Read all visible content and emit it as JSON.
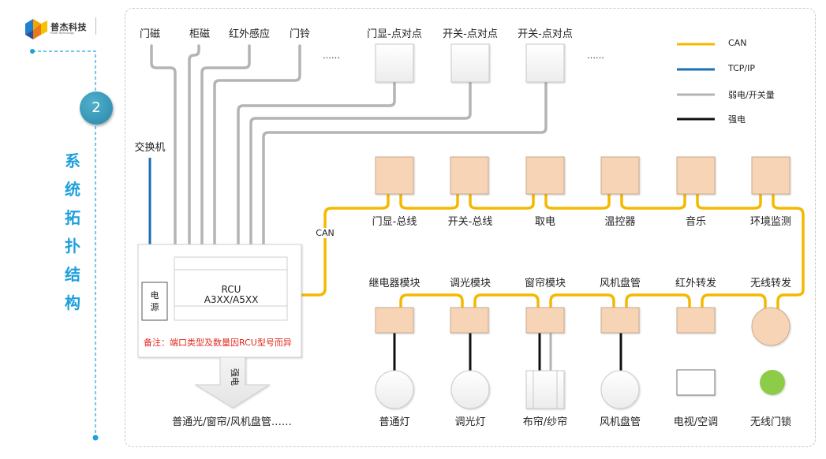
{
  "brand": {
    "name": "普杰科技",
    "subtitle": "Puzel Technology"
  },
  "section": {
    "number": "2",
    "title_chars": [
      "系",
      "统",
      "拓",
      "扑",
      "结",
      "构"
    ]
  },
  "colors": {
    "can": "#f5b800",
    "tcpip": "#1a6fb5",
    "weak": "#b4b4b4",
    "strong": "#111111",
    "accent": "#1ea0dc",
    "module_fill": "#f7d4b5",
    "lock_green": "#8dcc4a"
  },
  "legend": [
    {
      "label": "CAN",
      "color_key": "can"
    },
    {
      "label": "TCP/IP",
      "color_key": "tcpip"
    },
    {
      "label": "弱电/开关量",
      "color_key": "weak"
    },
    {
      "label": "强电",
      "color_key": "strong"
    }
  ],
  "dry_contacts": [
    "门磁",
    "柜磁",
    "红外感应",
    "门铃"
  ],
  "ellipsis": "……",
  "p2p_devices": [
    "门显-点对点",
    "开关-点对点",
    "开关-点对点"
  ],
  "switch": {
    "label": "交换机"
  },
  "can_label": "CAN",
  "rcu": {
    "name": "RCU",
    "model": "A3XX/A5XX",
    "power": [
      "电",
      "源"
    ],
    "note": "备注：端口类型及数量因RCU型号而异"
  },
  "strong_arrow": {
    "label": "强电",
    "targets": "普通光/窗帘/风机盘管……"
  },
  "bus_devices": [
    "门显-总线",
    "开关-总线",
    "取电",
    "温控器",
    "音乐",
    "环境监测"
  ],
  "modules": [
    "继电器模块",
    "调光模块",
    "窗帘模块",
    "风机盘管",
    "红外转发",
    "无线转发"
  ],
  "loads": [
    "普通灯",
    "调光灯",
    "布帘/纱帘",
    "风机盘管",
    "电视/空调",
    "无线门锁"
  ]
}
